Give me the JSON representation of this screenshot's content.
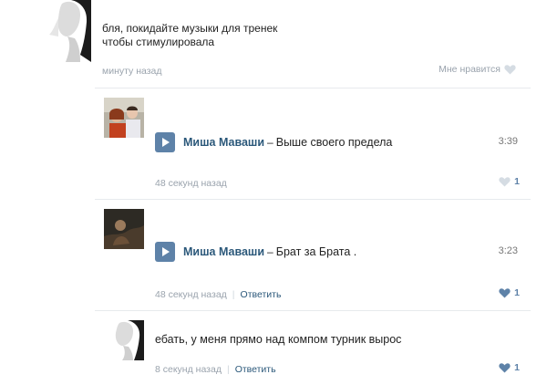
{
  "post": {
    "text_line1": "бля, покидайте музыки для тренек",
    "text_line2": "чтобы стимулировала",
    "time": "минуту назад",
    "like_label": "Мне нравится"
  },
  "comments": [
    {
      "artist": "Миша Маваши",
      "dash": "–",
      "title": "Выше своего предела",
      "duration": "3:39",
      "time": "48 секунд назад",
      "likes": "1"
    },
    {
      "artist": "Миша Маваши",
      "dash": "–",
      "title": "Брат за Брата .",
      "duration": "3:23",
      "time": "48 секунд назад",
      "reply": "Ответить",
      "separator": "|",
      "likes": "1"
    },
    {
      "text": "ебать, у меня прямо над компом турник вырос",
      "time": "8 секунд назад",
      "reply": "Ответить",
      "separator": "|",
      "likes": "1"
    }
  ],
  "colors": {
    "link": "#2b587a",
    "accent": "#5e82a8",
    "muted": "#9aa3ad"
  },
  "icons": {
    "play": "play-icon",
    "heart": "heart-icon"
  }
}
